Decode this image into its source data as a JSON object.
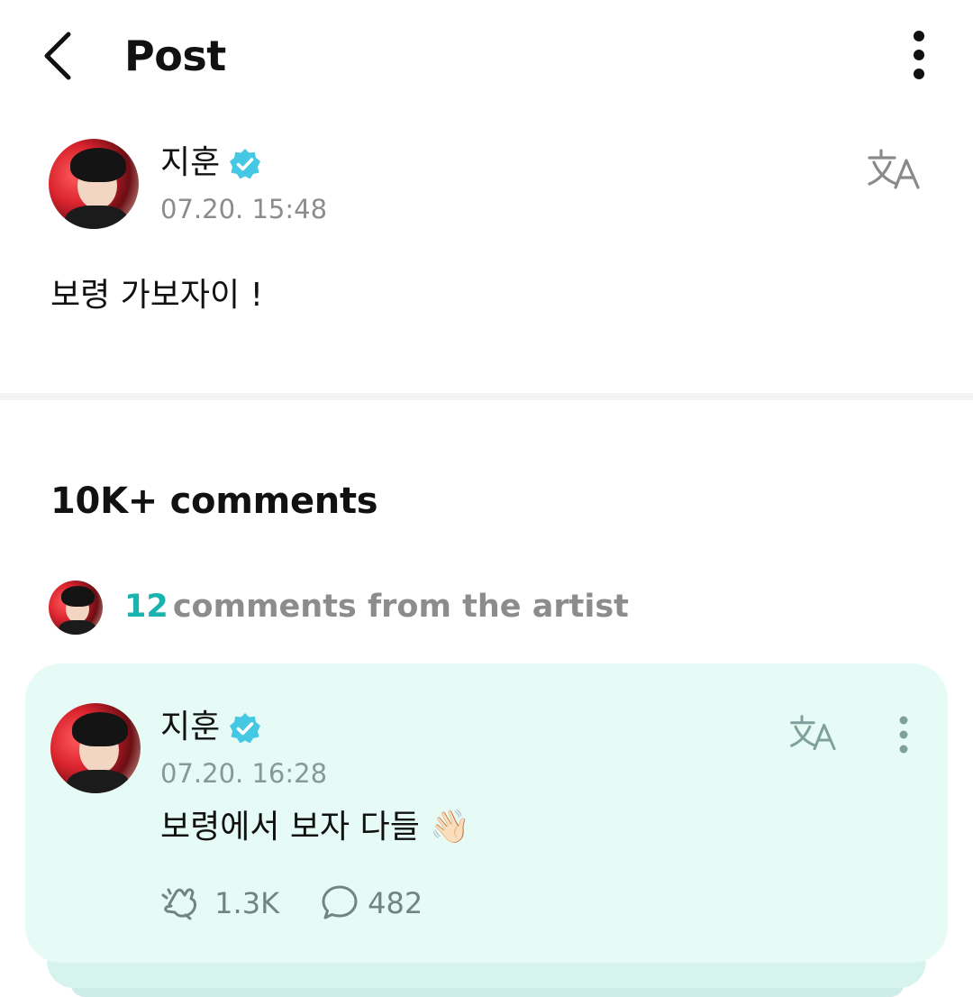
{
  "header": {
    "title": "Post"
  },
  "post": {
    "author": "지훈",
    "timestamp": "07.20. 15:48",
    "body": "보령 가보자이 !"
  },
  "comments": {
    "count_label": "10K+ comments",
    "artist_count": "12",
    "artist_label": "comments from the artist"
  },
  "artist_comment": {
    "author": "지훈",
    "timestamp": "07.20. 16:28",
    "text": "보령에서 보자 다들",
    "emoji": "👋🏻",
    "likes": "1.3K",
    "replies": "482"
  },
  "colors": {
    "accent": "#19b3b0",
    "verified": "#45c8e3",
    "card_bg": "#e6fbf6"
  },
  "icons": [
    "back-arrow-icon",
    "more-vertical-icon",
    "verified-icon",
    "translate-icon",
    "clap-icon",
    "comment-bubble-icon"
  ]
}
